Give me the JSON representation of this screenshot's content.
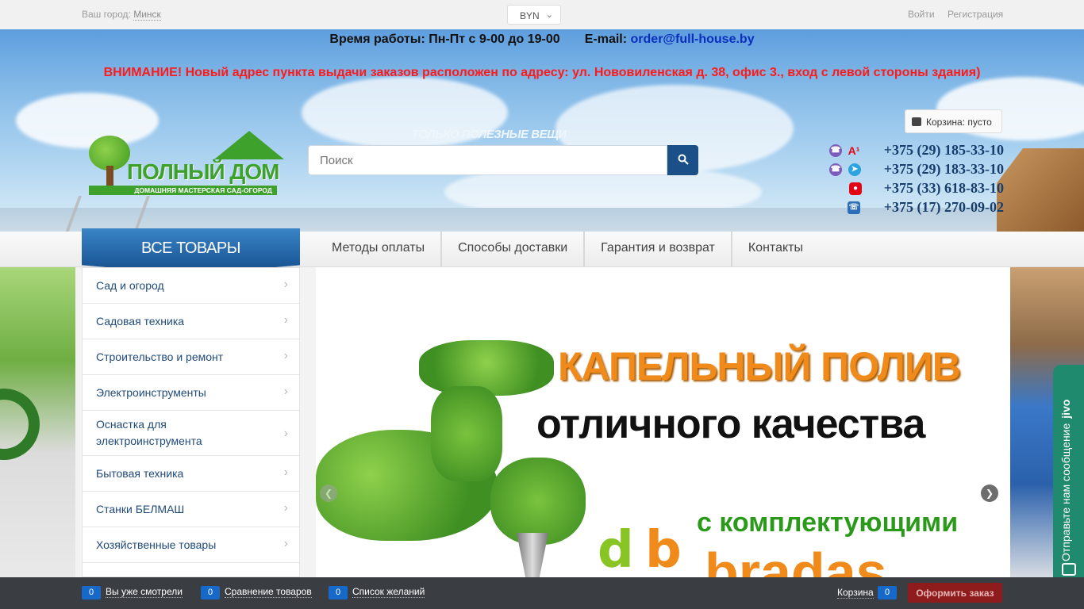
{
  "topbar": {
    "city_label": "Ваш город:",
    "city_value": "Минск",
    "currency": "BYN",
    "login": "Войти",
    "register": "Регистрация"
  },
  "header": {
    "worktime": "Время работы: Пн-Пт с 9-00 до 19-00",
    "email_label": "E-mail:",
    "email": "order@full-house.by",
    "attention": "ВНИМАНИЕ!  Новый адрес пункта выдачи заказов расположен по адресу: ул. Нововиленская д. 38, офис 3., вход с левой стороны здания)",
    "logo_name": "ПОЛНЫЙ ДОМ",
    "logo_tagline": "ДОМАШНЯЯ МАСТЕРСКАЯ САД-ОГОРОД",
    "slogan": "ТОЛЬКО ПОЛЕЗНЫЕ ВЕЩИ",
    "search_placeholder": "Поиск",
    "cart": "Корзина: пусто",
    "phones": [
      {
        "number": "+375 (29) 185-33-10",
        "icons": [
          "viber-icon",
          "a1-icon"
        ]
      },
      {
        "number": "+375 (29) 183-33-10",
        "icons": [
          "viber-icon",
          "telegram-icon"
        ]
      },
      {
        "number": "+375 (33) 618-83-10",
        "icons": [
          "mts-icon"
        ]
      },
      {
        "number": "+375 (17) 270-09-02",
        "icons": [
          "telephone-icon"
        ]
      }
    ]
  },
  "nav": {
    "all_goods": "ВСЕ ТОВАРЫ",
    "menu": [
      "Методы оплаты",
      "Способы доставки",
      "Гарантия и возврат",
      "Контакты"
    ]
  },
  "categories": [
    "Сад и огород",
    "Садовая техника",
    "Строительство и ремонт",
    "Электроинструменты",
    "Оснастка для электроинструмента",
    "Бытовая техника",
    "Станки БЕЛМАШ",
    "Хозяйственные товары"
  ],
  "banner": {
    "line1": "КАПЕЛЬНЫЙ ПОЛИВ",
    "line2": "отличного качества",
    "line3": "с комплектующими",
    "brand_partial": "bradas"
  },
  "jivo": {
    "text": "Отправьте нам сообщение",
    "logo": "jivo"
  },
  "bottombar": {
    "viewed_count": "0",
    "viewed": "Вы уже смотрели",
    "compare_count": "0",
    "compare": "Сравнение товаров",
    "wishlist_count": "0",
    "wishlist": "Список желаний",
    "basket": "Корзина",
    "basket_count": "0",
    "checkout": "Оформить заказ"
  },
  "colors": {
    "accent_blue": "#1f5e9e",
    "alert_red": "#ff1a1a",
    "brand_green": "#3ea12c",
    "banner_orange": "#f08a1a",
    "jivo_green": "#1f8a6d"
  }
}
